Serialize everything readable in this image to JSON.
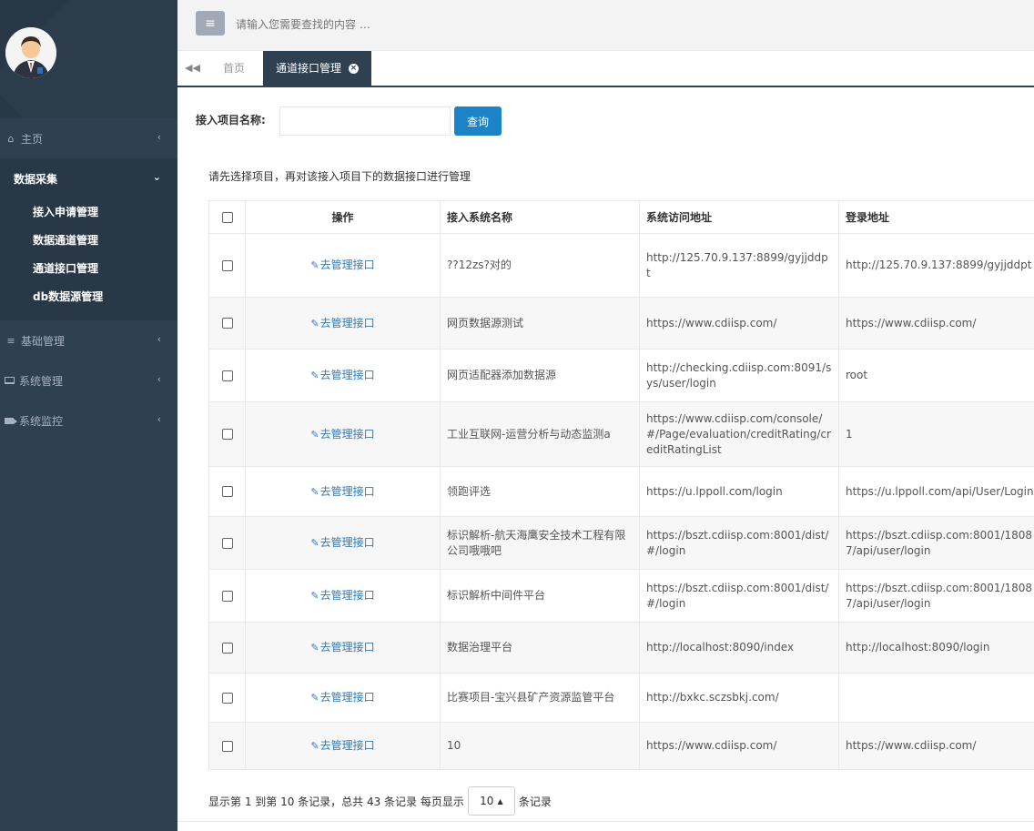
{
  "search": {
    "placeholder": "请输入您需要查找的内容 …"
  },
  "tabs": [
    {
      "label": "首页"
    },
    {
      "label": "通道接口管理"
    }
  ],
  "sidebar": {
    "items": [
      {
        "label": "主页"
      },
      {
        "label": "数据采集"
      },
      {
        "label": "基础管理"
      },
      {
        "label": "系统管理"
      },
      {
        "label": "系统监控"
      }
    ],
    "subitems": [
      {
        "label": "接入申请管理"
      },
      {
        "label": "数据通道管理"
      },
      {
        "label": "通道接口管理"
      },
      {
        "label": "db数据源管理"
      }
    ]
  },
  "filter": {
    "label": "接入项目名称:",
    "value": "",
    "button": "查询"
  },
  "hint": "请先选择项目，再对该接入项目下的数据接口进行管理",
  "table": {
    "headers": [
      "操作",
      "接入系统名称",
      "系统访问地址",
      "登录地址"
    ],
    "rows": [
      {
        "op": "去管理接口",
        "name": "??12zs?对的",
        "url": "http://125.70.9.137:8899/gyjjddpt",
        "login": "http://125.70.9.137:8899/gyjjddpt"
      },
      {
        "op": "去管理接口",
        "name": "网页数据源测试",
        "url": "https://www.cdiisp.com/",
        "login": "https://www.cdiisp.com/"
      },
      {
        "op": "去管理接口",
        "name": "网页适配器添加数据源",
        "url": "http://checking.cdiisp.com:8091/sys/user/login",
        "login": "root"
      },
      {
        "op": "去管理接口",
        "name": "工业互联网-运营分析与动态监测a",
        "url": "https://www.cdiisp.com/console/#/Page/evaluation/creditRating/creditRatingList",
        "login": "1"
      },
      {
        "op": "去管理接口",
        "name": "领跑评选",
        "url": "https://u.lppoll.com/login",
        "login": "https://u.lppoll.com/api/User/Login"
      },
      {
        "op": "去管理接口",
        "name": "标识解析-航天海鹰安全技术工程有限公司哦哦吧",
        "url": "https://bszt.cdiisp.com:8001/dist/#/login",
        "login": "https://bszt.cdiisp.com:8001/18087/api/user/login"
      },
      {
        "op": "去管理接口",
        "name": "标识解析中间件平台",
        "url": "https://bszt.cdiisp.com:8001/dist/#/login",
        "login": "https://bszt.cdiisp.com:8001/18087/api/user/login"
      },
      {
        "op": "去管理接口",
        "name": "数据治理平台",
        "url": "http://localhost:8090/index",
        "login": "http://localhost:8090/login"
      },
      {
        "op": "去管理接口",
        "name": "比赛项目-宝兴县矿产资源监管平台",
        "url": "http://bxkc.sczsbkj.com/",
        "login": ""
      },
      {
        "op": "去管理接口",
        "name": "10",
        "url": "https://www.cdiisp.com/",
        "login": "https://www.cdiisp.com/"
      }
    ]
  },
  "footer": {
    "summary": "显示第 1 到第 10 条记录，总共 43 条记录 每页显示",
    "pagesize": "10",
    "suffix": "条记录"
  }
}
